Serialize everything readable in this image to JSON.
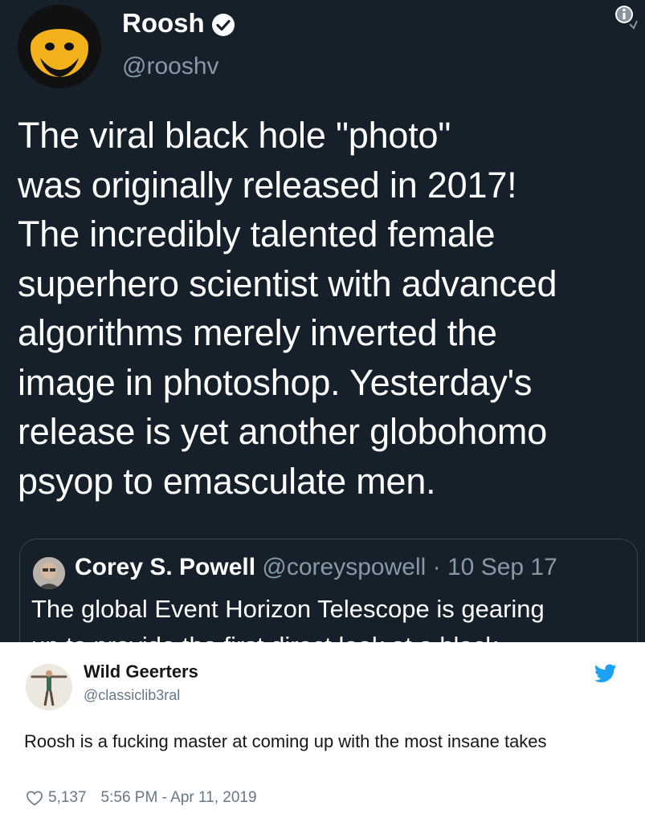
{
  "original_tweet": {
    "author_name": "Roosh",
    "author_handle": "@rooshv",
    "text": "The viral black hole \"photo\"\nwas originally released in 2017!\nThe incredibly talented female\nsuperhero scientist with advanced\nalgorithms merely inverted the\nimage in photoshop. Yesterday's\nrelease is yet another globohomo\npsyop to emasculate men.",
    "quoted": {
      "name": "Corey S. Powell",
      "handle": "@coreyspowell",
      "separator": "·",
      "date": "10 Sep 17",
      "text": "The global Event Horizon Telescope is gearing\nup to provide the first direct look at a black"
    }
  },
  "reply_tweet": {
    "author_name": "Wild Geerters",
    "author_handle": "@classiclib3ral",
    "text": "Roosh is a fucking master at coming up with the most insane takes",
    "likes": "5,137",
    "timestamp": "5:56 PM - Apr 11, 2019"
  },
  "colors": {
    "dark_bg": "#15202b",
    "twitter_blue": "#1da1f2",
    "muted": "#8899a6"
  },
  "icons": [
    "verified-badge-icon",
    "info-icon",
    "twitter-bird-icon",
    "heart-icon"
  ]
}
